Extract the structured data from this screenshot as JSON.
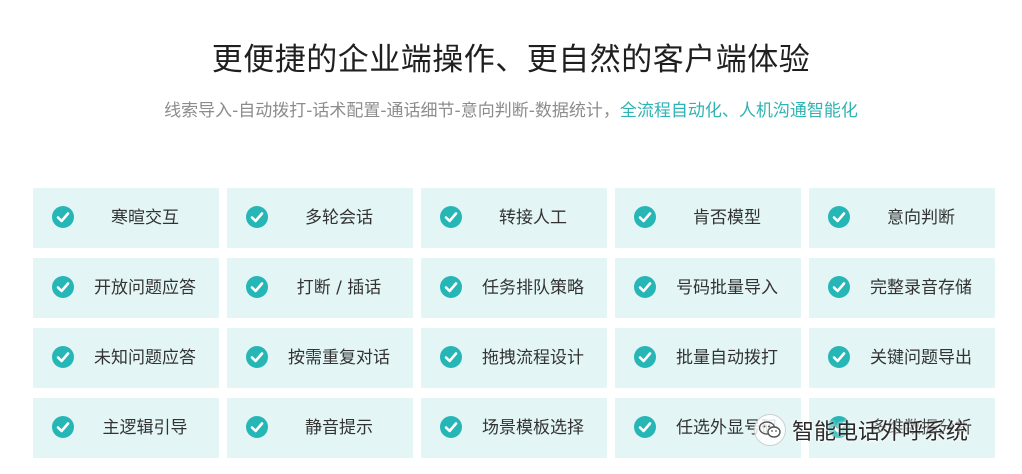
{
  "header": {
    "title": "更便捷的企业端操作、更自然的客户端体验",
    "subtitle_plain": "线索导入-自动拨打-话术配置-通话细节-意向判断-数据统计，",
    "subtitle_highlight": "全流程自动化、人机沟通智能化"
  },
  "features": [
    "寒暄交互",
    "多轮会话",
    "转接人工",
    "肯否模型",
    "意向判断",
    "开放问题应答",
    "打断 / 插话",
    "任务排队策略",
    "号码批量导入",
    "完整录音存储",
    "未知问题应答",
    "按需重复对话",
    "拖拽流程设计",
    "批量自动拨打",
    "关键问题导出",
    "主逻辑引导",
    "静音提示",
    "场景模板选择",
    "任选外显号码",
    "多维数据分析"
  ],
  "watermark": {
    "text": "智能电话外呼系统",
    "icon": "wechat-icon"
  },
  "colors": {
    "accent": "#27b6b6",
    "card_bg": "#e3f5f5",
    "highlight_text": "#2fb3b3"
  }
}
